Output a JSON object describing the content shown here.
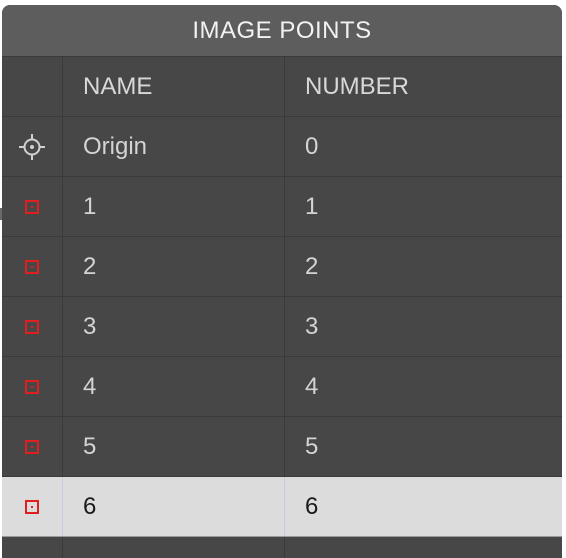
{
  "panel": {
    "title": "IMAGE POINTS"
  },
  "table": {
    "columns": [
      "",
      "NAME",
      "NUMBER"
    ],
    "rows": [
      {
        "icon": "crosshair-icon",
        "name": "Origin",
        "number": "0",
        "selected": false
      },
      {
        "icon": "red-point-icon",
        "name": "1",
        "number": "1",
        "selected": false
      },
      {
        "icon": "red-point-icon",
        "name": "2",
        "number": "2",
        "selected": false
      },
      {
        "icon": "red-point-icon",
        "name": "3",
        "number": "3",
        "selected": false
      },
      {
        "icon": "red-point-icon",
        "name": "4",
        "number": "4",
        "selected": false
      },
      {
        "icon": "red-point-icon",
        "name": "5",
        "number": "5",
        "selected": false
      },
      {
        "icon": "red-point-icon",
        "name": "6",
        "number": "6",
        "selected": true
      }
    ]
  },
  "colors": {
    "panel_bg": "#474747",
    "title_bg": "#5d5d5d",
    "selected_row_bg": "#dcdcdc",
    "point_icon": "#e02020"
  }
}
